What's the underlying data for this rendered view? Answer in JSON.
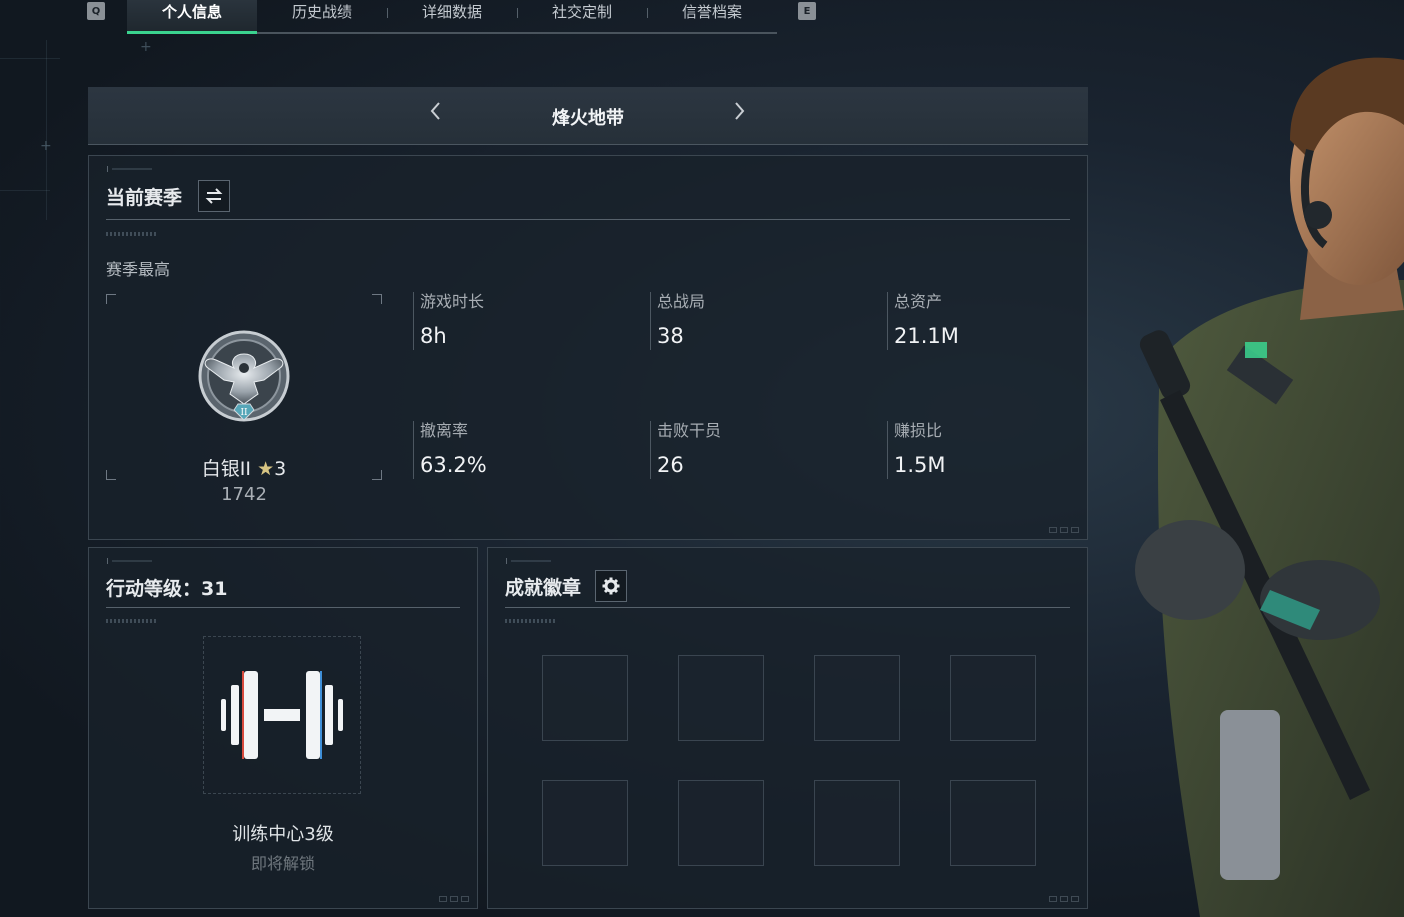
{
  "tabbar": {
    "left_key": "Q",
    "right_key": "E",
    "tabs": [
      {
        "label": "个人信息",
        "active": true
      },
      {
        "label": "历史战绩",
        "active": false
      },
      {
        "label": "详细数据",
        "active": false
      },
      {
        "label": "社交定制",
        "active": false
      },
      {
        "label": "信誉档案",
        "active": false
      }
    ]
  },
  "mode_selector": {
    "title": "烽火地带",
    "prev_icon": "chevron-left-icon",
    "next_icon": "chevron-right-icon"
  },
  "season_panel": {
    "title": "当前赛季",
    "toggle_icon": "swap-icon",
    "season_best_label": "赛季最高",
    "rank": {
      "name": "白银II",
      "stars": "3",
      "star_icon": "star-icon",
      "emblem_icon": "silver-eagle-emblem-icon",
      "score": "1742"
    },
    "stats": [
      {
        "label": "游戏时长",
        "value": "8h"
      },
      {
        "label": "总战局",
        "value": "38"
      },
      {
        "label": "总资产",
        "value": "21.1M"
      },
      {
        "label": "撤离率",
        "value": "63.2%"
      },
      {
        "label": "击败干员",
        "value": "26"
      },
      {
        "label": "赚损比",
        "value": "1.5M"
      }
    ]
  },
  "level_panel": {
    "title": "行动等级：31",
    "icon": "dumbbell-icon",
    "facility_name": "训练中心3级",
    "status": "即将解锁"
  },
  "badges_panel": {
    "title": "成就徽章",
    "settings_icon": "gear-icon",
    "slot_count": 8
  },
  "colors": {
    "accent_green": "#3bd38f",
    "panel_bg": "#18212a",
    "text_primary": "#f1f3f5",
    "text_secondary": "#a7adb3"
  }
}
